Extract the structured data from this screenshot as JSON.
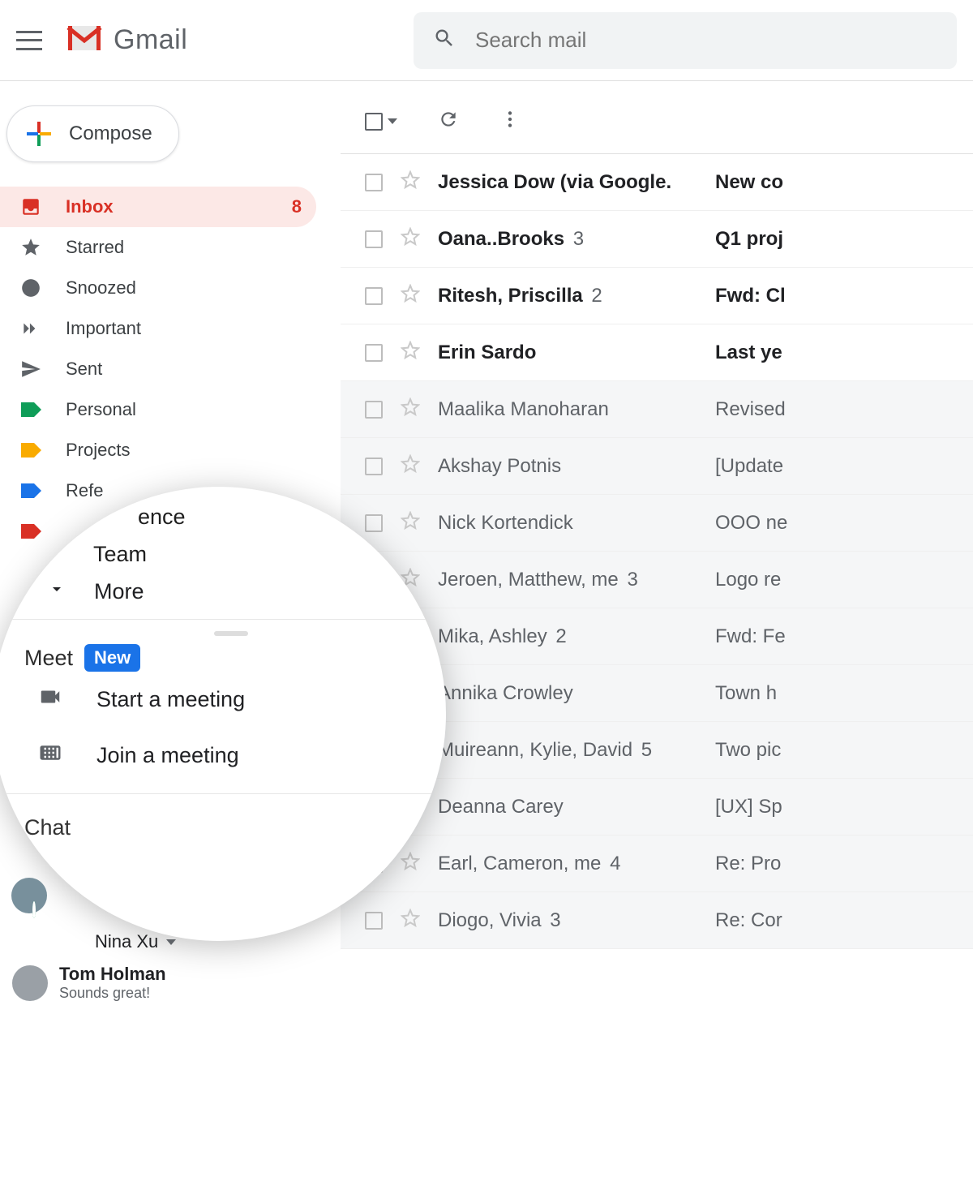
{
  "header": {
    "app_name": "Gmail",
    "search_placeholder": "Search mail"
  },
  "compose": {
    "label": "Compose"
  },
  "sidebar": {
    "items": [
      {
        "label": "Inbox",
        "icon": "inbox",
        "count": "8",
        "active": true
      },
      {
        "label": "Starred",
        "icon": "star"
      },
      {
        "label": "Snoozed",
        "icon": "clock"
      },
      {
        "label": "Important",
        "icon": "chevrons"
      },
      {
        "label": "Sent",
        "icon": "send"
      },
      {
        "label": "Personal",
        "icon": "tag",
        "color": "#0f9d58"
      },
      {
        "label": "Projects",
        "icon": "tag",
        "color": "#f9ab00"
      },
      {
        "label": "Refe",
        "icon": "tag",
        "color": "#1a73e8"
      },
      {
        "label": "",
        "icon": "tag",
        "color": "#d93025"
      }
    ]
  },
  "zoom": {
    "partial_label_top": "ence",
    "label_team": "Team",
    "more": "More",
    "meet_title": "Meet",
    "badge": "New",
    "start": "Start a meeting",
    "join": "Join a meeting",
    "chat_title": "Chat"
  },
  "under": {
    "nina": "Nina Xu",
    "contact_name": "Tom Holman",
    "contact_status": "Sounds great!"
  },
  "messages": [
    {
      "sender": "Jessica Dow (via Google.",
      "count": "",
      "subject": "New co",
      "read": false
    },
    {
      "sender": "Oana..Brooks",
      "count": "3",
      "subject": "Q1 proj",
      "read": false
    },
    {
      "sender": "Ritesh, Priscilla",
      "count": "2",
      "subject": "Fwd: Cl",
      "read": false
    },
    {
      "sender": "Erin Sardo",
      "count": "",
      "subject": "Last ye",
      "read": false
    },
    {
      "sender": "Maalika Manoharan",
      "count": "",
      "subject": "Revised",
      "read": true
    },
    {
      "sender": "Akshay Potnis",
      "count": "",
      "subject": "[Update",
      "read": true
    },
    {
      "sender": "Nick Kortendick",
      "count": "",
      "subject": "OOO ne",
      "read": true
    },
    {
      "sender": "Jeroen, Matthew, me",
      "count": "3",
      "subject": "Logo re",
      "read": true
    },
    {
      "sender": "Mika, Ashley",
      "count": "2",
      "subject": "Fwd: Fe",
      "read": true
    },
    {
      "sender": "Annika Crowley",
      "count": "",
      "subject": "Town h",
      "read": true
    },
    {
      "sender": "Muireann, Kylie, David",
      "count": "5",
      "subject": "Two pic",
      "read": true
    },
    {
      "sender": "Deanna Carey",
      "count": "",
      "subject": "[UX] Sp",
      "read": true
    },
    {
      "sender": "Earl, Cameron, me",
      "count": "4",
      "subject": "Re: Pro",
      "read": true
    },
    {
      "sender": "Diogo, Vivia",
      "count": "3",
      "subject": "Re: Cor",
      "read": true
    }
  ]
}
